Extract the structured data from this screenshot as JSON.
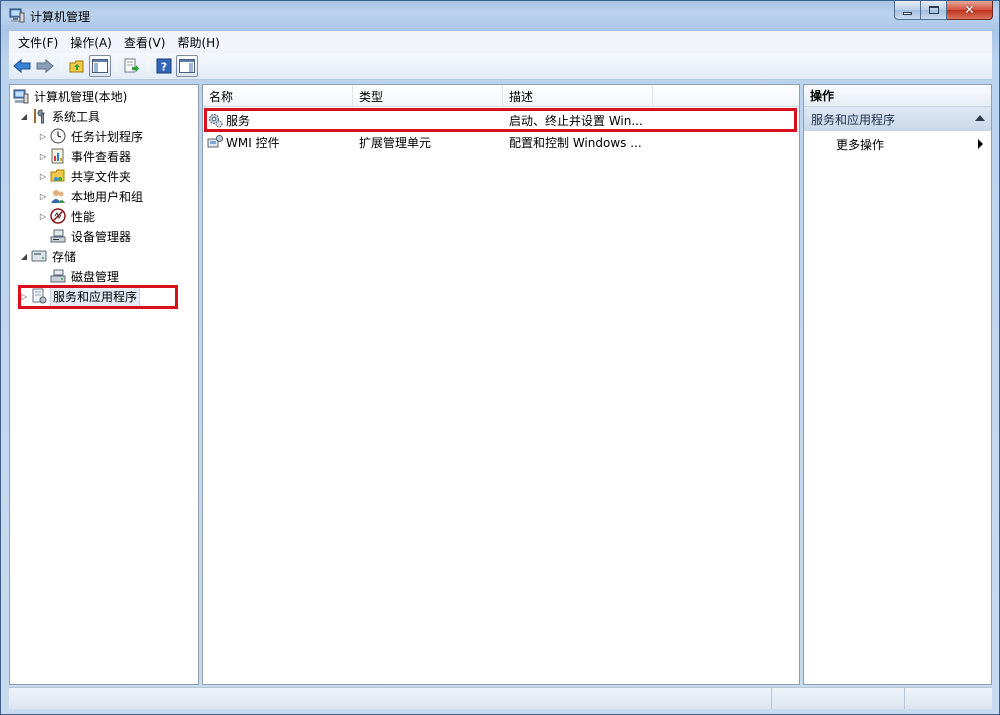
{
  "window": {
    "title": "计算机管理",
    "controls": {
      "minimize": "minimize",
      "maximize": "maximize",
      "close": "close"
    }
  },
  "menu": {
    "items": [
      "文件(F)",
      "操作(A)",
      "查看(V)",
      "帮助(H)"
    ]
  },
  "toolbar": {
    "buttons": [
      "back-arrow-icon",
      "forward-arrow-icon",
      "up-folder-icon",
      "show-hide-tree-icon",
      "export-list-icon",
      "help-icon",
      "show-hide-action-pane-icon"
    ]
  },
  "tree": {
    "root": "计算机管理(本地)",
    "system_tools": "系统工具",
    "task_scheduler": "任务计划程序",
    "event_viewer": "事件查看器",
    "shared_folders": "共享文件夹",
    "local_users": "本地用户和组",
    "performance": "性能",
    "device_manager": "设备管理器",
    "storage": "存储",
    "disk_management": "磁盘管理",
    "services_apps": "服务和应用程序"
  },
  "list": {
    "columns": {
      "name": "名称",
      "type": "类型",
      "description": "描述"
    },
    "rows": [
      {
        "name": "服务",
        "type": "",
        "description": "启动、终止并设置 Win..."
      },
      {
        "name": "WMI 控件",
        "type": "扩展管理单元",
        "description": "配置和控制 Windows ..."
      }
    ]
  },
  "actions": {
    "title": "操作",
    "section": "服务和应用程序",
    "more": "更多操作"
  },
  "colors": {
    "highlight": "#d9101c",
    "title_gradient_top": "#a7c4e6",
    "pane_border": "#8e9fb4"
  }
}
